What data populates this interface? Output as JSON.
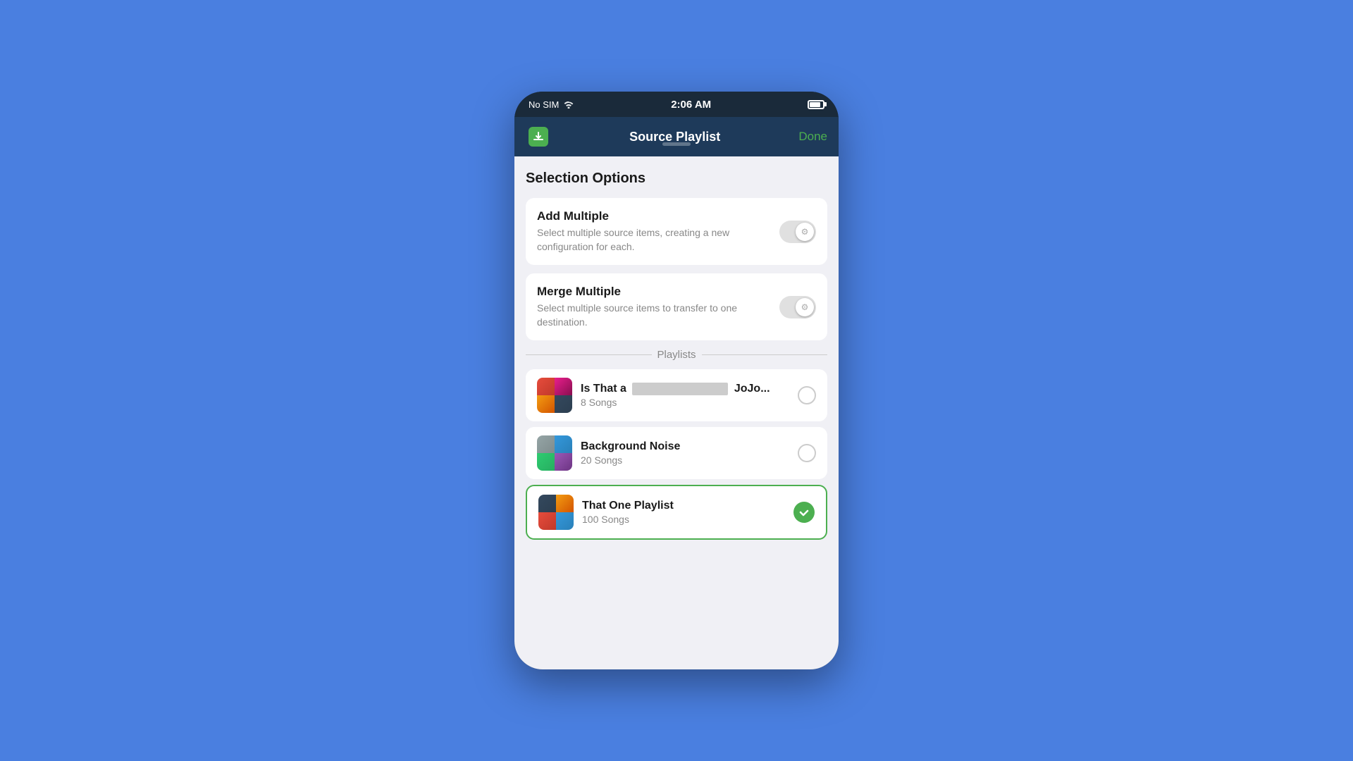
{
  "statusBar": {
    "noSim": "No SIM",
    "time": "2:06 AM"
  },
  "navBar": {
    "title": "Source Playlist",
    "doneLabel": "Done"
  },
  "selectionOptions": {
    "header": "Selection Options",
    "addMultiple": {
      "title": "Add Multiple",
      "description": "Select multiple source items, creating a new configuration for each."
    },
    "mergeMultiple": {
      "title": "Merge Multiple",
      "description": "Select multiple source items to transfer to one destination."
    }
  },
  "playlists": {
    "header": "Playlists",
    "items": [
      {
        "id": "playlist-1",
        "name": "Is That a",
        "nameBlurred": "████████████",
        "nameSuffix": "JoJo...",
        "count": "8 Songs",
        "selected": false
      },
      {
        "id": "playlist-2",
        "name": "Background Noise",
        "count": "20 Songs",
        "selected": false
      },
      {
        "id": "playlist-3",
        "name": "That One Playlist",
        "count": "100 Songs",
        "selected": true
      }
    ]
  }
}
